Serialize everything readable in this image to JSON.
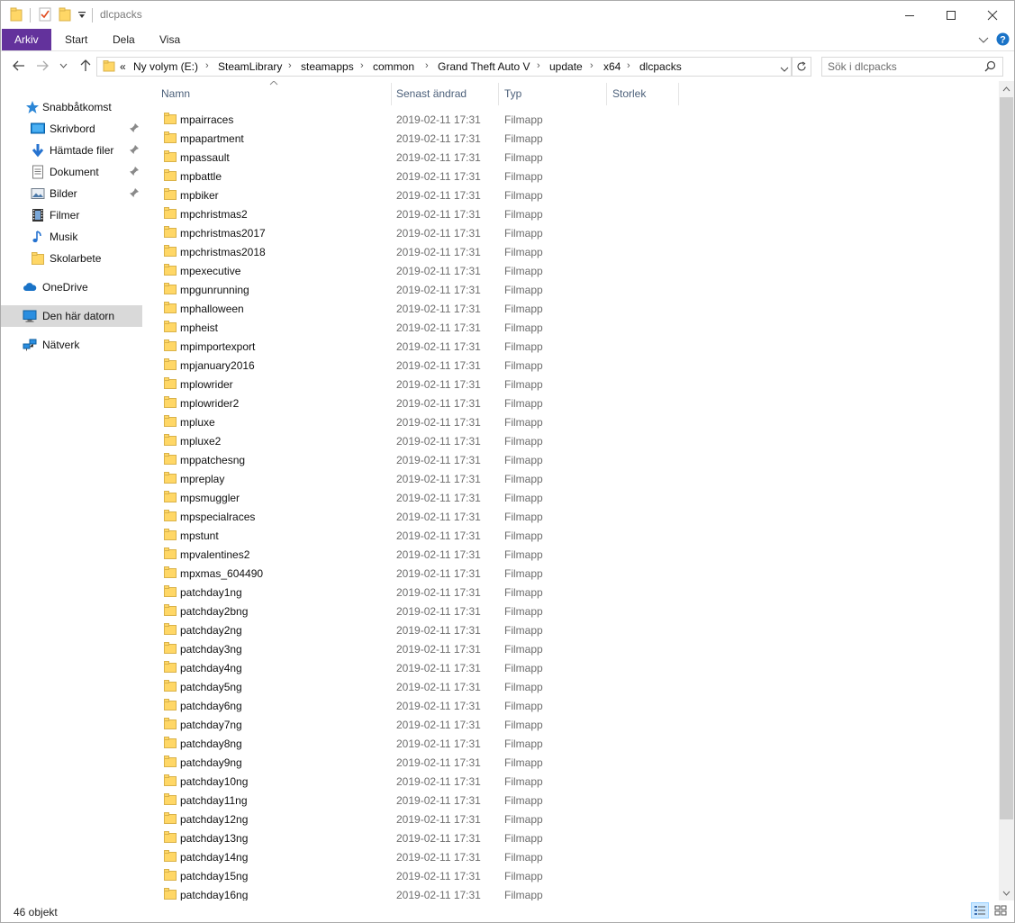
{
  "window": {
    "title": "dlcpacks",
    "minimize_icon": "minimize-icon",
    "maximize_icon": "maximize-icon",
    "close_icon": "close-icon"
  },
  "ribbon": {
    "tabs": [
      {
        "label": "Arkiv"
      },
      {
        "label": "Start"
      },
      {
        "label": "Dela"
      },
      {
        "label": "Visa"
      }
    ]
  },
  "address": {
    "overflow": "«",
    "crumbs": [
      "Ny volym (E:)",
      "SteamLibrary",
      "steamapps",
      "common",
      "Grand Theft Auto V",
      "update",
      "x64",
      "dlcpacks"
    ],
    "search_placeholder": "Sök i dlcpacks"
  },
  "nav": {
    "items": [
      {
        "label": "Snabbåtkomst",
        "icon": "star-icon"
      },
      {
        "label": "Skrivbord",
        "icon": "desktop-icon",
        "pinned": true
      },
      {
        "label": "Hämtade filer",
        "icon": "download-icon",
        "pinned": true
      },
      {
        "label": "Dokument",
        "icon": "document-icon",
        "pinned": true
      },
      {
        "label": "Bilder",
        "icon": "pictures-icon",
        "pinned": true
      },
      {
        "label": "Filmer",
        "icon": "film-icon"
      },
      {
        "label": "Musik",
        "icon": "music-icon"
      },
      {
        "label": "Skolarbete",
        "icon": "folder-icon"
      },
      {
        "label": "OneDrive",
        "icon": "cloud-icon"
      },
      {
        "label": "Den här datorn",
        "icon": "computer-icon",
        "selected": true
      },
      {
        "label": "Nätverk",
        "icon": "network-icon"
      }
    ]
  },
  "columns": {
    "name": "Namn",
    "modified": "Senast ändrad",
    "type": "Typ",
    "size": "Storlek"
  },
  "files": [
    {
      "name": "mpairraces",
      "modified": "2019-02-11 17:31",
      "type": "Filmapp"
    },
    {
      "name": "mpapartment",
      "modified": "2019-02-11 17:31",
      "type": "Filmapp"
    },
    {
      "name": "mpassault",
      "modified": "2019-02-11 17:31",
      "type": "Filmapp"
    },
    {
      "name": "mpbattle",
      "modified": "2019-02-11 17:31",
      "type": "Filmapp"
    },
    {
      "name": "mpbiker",
      "modified": "2019-02-11 17:31",
      "type": "Filmapp"
    },
    {
      "name": "mpchristmas2",
      "modified": "2019-02-11 17:31",
      "type": "Filmapp"
    },
    {
      "name": "mpchristmas2017",
      "modified": "2019-02-11 17:31",
      "type": "Filmapp"
    },
    {
      "name": "mpchristmas2018",
      "modified": "2019-02-11 17:31",
      "type": "Filmapp"
    },
    {
      "name": "mpexecutive",
      "modified": "2019-02-11 17:31",
      "type": "Filmapp"
    },
    {
      "name": "mpgunrunning",
      "modified": "2019-02-11 17:31",
      "type": "Filmapp"
    },
    {
      "name": "mphalloween",
      "modified": "2019-02-11 17:31",
      "type": "Filmapp"
    },
    {
      "name": "mpheist",
      "modified": "2019-02-11 17:31",
      "type": "Filmapp"
    },
    {
      "name": "mpimportexport",
      "modified": "2019-02-11 17:31",
      "type": "Filmapp"
    },
    {
      "name": "mpjanuary2016",
      "modified": "2019-02-11 17:31",
      "type": "Filmapp"
    },
    {
      "name": "mplowrider",
      "modified": "2019-02-11 17:31",
      "type": "Filmapp"
    },
    {
      "name": "mplowrider2",
      "modified": "2019-02-11 17:31",
      "type": "Filmapp"
    },
    {
      "name": "mpluxe",
      "modified": "2019-02-11 17:31",
      "type": "Filmapp"
    },
    {
      "name": "mpluxe2",
      "modified": "2019-02-11 17:31",
      "type": "Filmapp"
    },
    {
      "name": "mppatchesng",
      "modified": "2019-02-11 17:31",
      "type": "Filmapp"
    },
    {
      "name": "mpreplay",
      "modified": "2019-02-11 17:31",
      "type": "Filmapp"
    },
    {
      "name": "mpsmuggler",
      "modified": "2019-02-11 17:31",
      "type": "Filmapp"
    },
    {
      "name": "mpspecialraces",
      "modified": "2019-02-11 17:31",
      "type": "Filmapp"
    },
    {
      "name": "mpstunt",
      "modified": "2019-02-11 17:31",
      "type": "Filmapp"
    },
    {
      "name": "mpvalentines2",
      "modified": "2019-02-11 17:31",
      "type": "Filmapp"
    },
    {
      "name": "mpxmas_604490",
      "modified": "2019-02-11 17:31",
      "type": "Filmapp"
    },
    {
      "name": "patchday1ng",
      "modified": "2019-02-11 17:31",
      "type": "Filmapp"
    },
    {
      "name": "patchday2bng",
      "modified": "2019-02-11 17:31",
      "type": "Filmapp"
    },
    {
      "name": "patchday2ng",
      "modified": "2019-02-11 17:31",
      "type": "Filmapp"
    },
    {
      "name": "patchday3ng",
      "modified": "2019-02-11 17:31",
      "type": "Filmapp"
    },
    {
      "name": "patchday4ng",
      "modified": "2019-02-11 17:31",
      "type": "Filmapp"
    },
    {
      "name": "patchday5ng",
      "modified": "2019-02-11 17:31",
      "type": "Filmapp"
    },
    {
      "name": "patchday6ng",
      "modified": "2019-02-11 17:31",
      "type": "Filmapp"
    },
    {
      "name": "patchday7ng",
      "modified": "2019-02-11 17:31",
      "type": "Filmapp"
    },
    {
      "name": "patchday8ng",
      "modified": "2019-02-11 17:31",
      "type": "Filmapp"
    },
    {
      "name": "patchday9ng",
      "modified": "2019-02-11 17:31",
      "type": "Filmapp"
    },
    {
      "name": "patchday10ng",
      "modified": "2019-02-11 17:31",
      "type": "Filmapp"
    },
    {
      "name": "patchday11ng",
      "modified": "2019-02-11 17:31",
      "type": "Filmapp"
    },
    {
      "name": "patchday12ng",
      "modified": "2019-02-11 17:31",
      "type": "Filmapp"
    },
    {
      "name": "patchday13ng",
      "modified": "2019-02-11 17:31",
      "type": "Filmapp"
    },
    {
      "name": "patchday14ng",
      "modified": "2019-02-11 17:31",
      "type": "Filmapp"
    },
    {
      "name": "patchday15ng",
      "modified": "2019-02-11 17:31",
      "type": "Filmapp"
    },
    {
      "name": "patchday16ng",
      "modified": "2019-02-11 17:31",
      "type": "Filmapp"
    }
  ],
  "status": {
    "count": "46 objekt"
  },
  "colors": {
    "file_tab": "#63329c",
    "folder": "#ffd766",
    "selected_nav": "#d9d9d9",
    "header_text": "#4c607a"
  }
}
